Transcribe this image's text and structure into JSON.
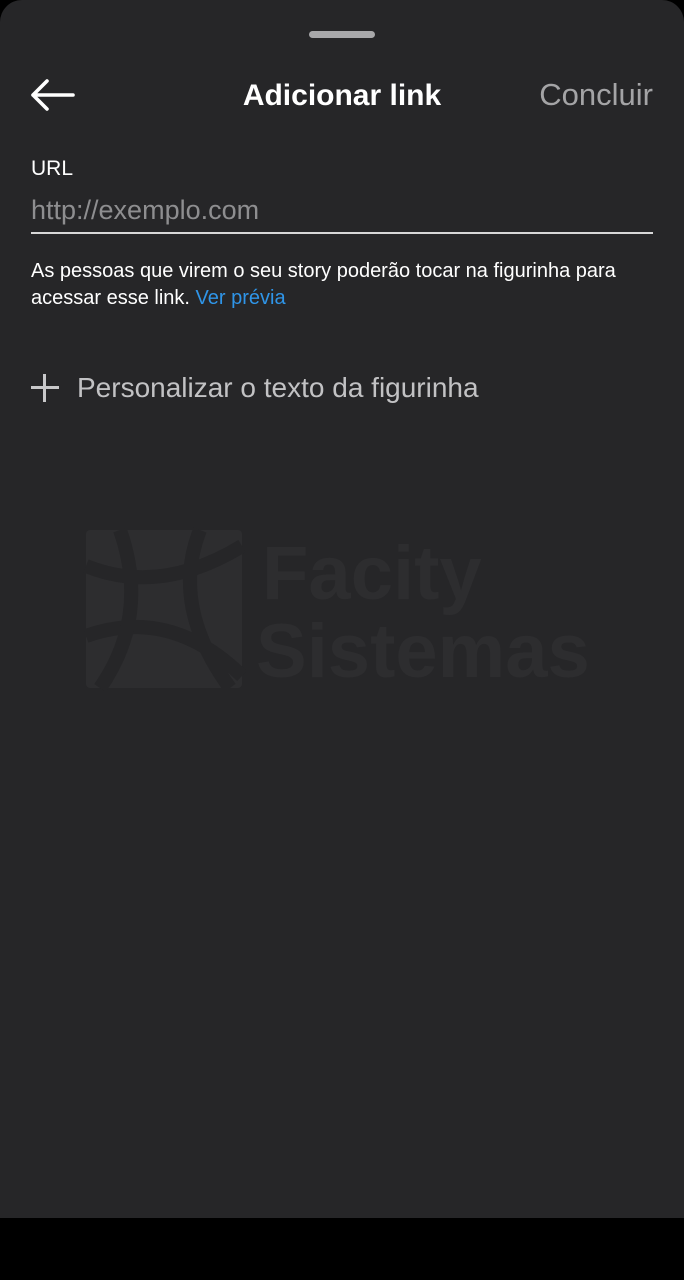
{
  "header": {
    "back_icon": "arrow-left-icon",
    "title": "Adicionar link",
    "done_label": "Concluir"
  },
  "url_field": {
    "label": "URL",
    "placeholder": "http://exemplo.com",
    "value": ""
  },
  "helper": {
    "text": "As pessoas que virem o seu story poderão tocar na figurinha para acessar esse link.",
    "preview_link": "Ver prévia"
  },
  "customize": {
    "icon": "plus-icon",
    "label": "Personalizar o texto da figurinha"
  },
  "watermark": {
    "line1": "Facity",
    "line2": "Sistemas"
  },
  "colors": {
    "background": "#262628",
    "accent_link": "#2f95e8",
    "title_text": "#ffffff",
    "muted_text": "#a4a4a6"
  }
}
